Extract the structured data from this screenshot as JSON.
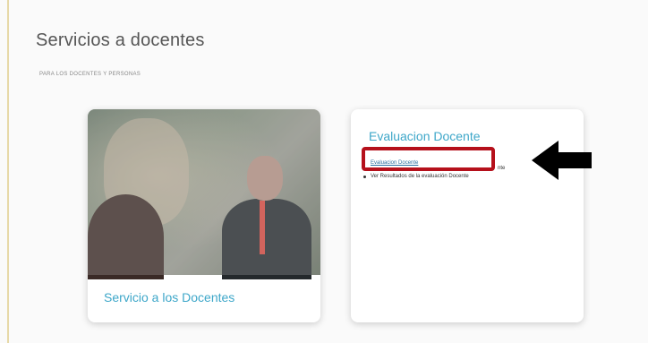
{
  "page": {
    "title": "Servicios a docentes",
    "subtitle": "PARA LOS DOCENTES Y PERSONAS"
  },
  "cards": [
    {
      "label": "Servicio a los Docentes",
      "image": "photo-people"
    },
    {
      "title": "Evaluacion Docente",
      "items": [
        {
          "label": "Evaluacion Docente",
          "link": true
        },
        {
          "label": "nte",
          "link": false
        },
        {
          "label": "Ver Resultados de la evaluación Docente",
          "link": false
        }
      ]
    }
  ],
  "annotation": {
    "arrow_icon": "left-arrow-icon",
    "highlight_color": "#b5101b",
    "arrow_color": "#000000"
  }
}
